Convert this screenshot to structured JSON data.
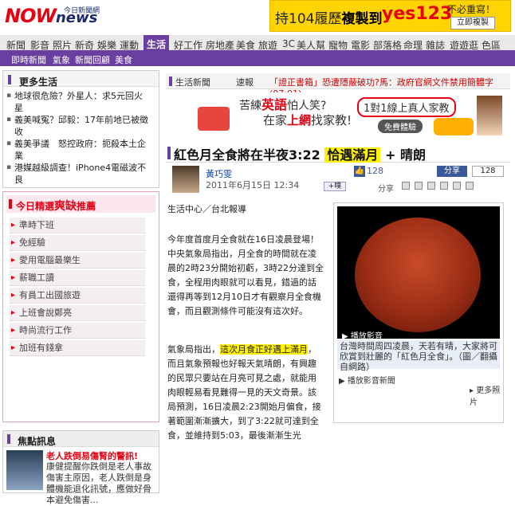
{
  "header": {
    "logo_main": "NOW",
    "logo_sub": "news",
    "logo_tag": "今日新聞網",
    "ad_text_a": "持104履歷",
    "ad_text_b": "複製到",
    "ad_brand": "yes123",
    "ad_slogan": "不必重寫！",
    "ad_button": "立即複製"
  },
  "nav": {
    "items": [
      "新聞",
      "影音",
      "照片",
      "新奇",
      "娛樂",
      "運動",
      "生活",
      "好工作",
      "房地產",
      "美食",
      "旅遊",
      "3C",
      "美人幫",
      "寵物",
      "電影",
      "部落格",
      "命理",
      "雜誌",
      "遊遊逛",
      "色區"
    ],
    "active": "生活"
  },
  "subnav": {
    "items": [
      "即時新聞",
      "氣象",
      "新聞回顧",
      "美食"
    ]
  },
  "more_life": {
    "title": "更多生活",
    "items": [
      "地球很危險？外星人：求5元回火星",
      "義美喊冤？邱毅：17年前地已被徵收",
      "義美爭議　怒控政府：扼殺本土企業",
      "港媒越級調查！iPhone4電磁波不良"
    ]
  },
  "featured": {
    "title_a": "今日精選",
    "title_b": "爽缺",
    "title_c": "推薦",
    "items": [
      "準時下班",
      "免經驗",
      "愛用電腦最樂生",
      "薪職工讀",
      "有員工出國旅遊",
      "上班會說鄭亮",
      "時尚流行工作",
      "加班有錢拿"
    ]
  },
  "focus": {
    "title": "焦點訊息",
    "headline": "老人跌倒易傷腎的警訊!",
    "body": "康健提醒你跌倒是老人事故傷害主原因，老人跌倒是身體機能退化訊號，應做好骨本避免傷害..."
  },
  "breadcrumb": {
    "section": "生活新聞",
    "flash": "速報",
    "headline": "「證正書箱」恐遭隱蔽破功?馬：政府官網文件禁用簡體字 (07:01)"
  },
  "mid_ad": {
    "line1_a": "苦練",
    "line1_b": "英語",
    "line1_c": "怕人笑?",
    "line2_a": "在家",
    "line2_b": "上網",
    "line2_c": "找家教!",
    "tag": "1對1線上真人家教",
    "button": "免費體驗"
  },
  "article": {
    "title_main": "紅色月全食將在半夜3:22",
    "title_hl": "恰遇滿月",
    "title_tail": " + 晴朗",
    "author": "黃巧雯",
    "date": "2011年6月15日 12:34",
    "location": "生活中心／台北報導",
    "para1": "今年度首度月全食就在16日凌晨登場！中央氣象局指出，月全食的時間就在凌晨的2時23分開始初虧，3時22分達到全食，全程用肉眼就可以看見，錯過的話還得再等到12月10日才有觀察月全食機會，而且觀測條件可能沒有這次好。",
    "para2_pre": "氣象局指出，",
    "para2_hl": "這次月食正好遇上滿月",
    "para2_post": "，而且氣象預報也好報天氣晴朗，有興趣的民眾只要站在月亮可見之處，就能用肉眼輕易看見難得一見的天文奇景。該局預測，16日凌晨2:23開始月偏食，接著範圍漸漸擴大，到了3:22就可達到全食，並維持到5:03，最後漸漸生光"
  },
  "social": {
    "share_label": "分享",
    "share_count": "128",
    "like_count": "128",
    "plurk": "+噗",
    "share_row": "分享"
  },
  "photo": {
    "play_label": "播放影音",
    "caption": "台灣時間周四凌晨，天若有晴，大家將可欣賞到壯麗的「紅色月全食」。（圖／翻攝自網路）",
    "playlist": "播放影音新聞",
    "more": "更多照片"
  }
}
